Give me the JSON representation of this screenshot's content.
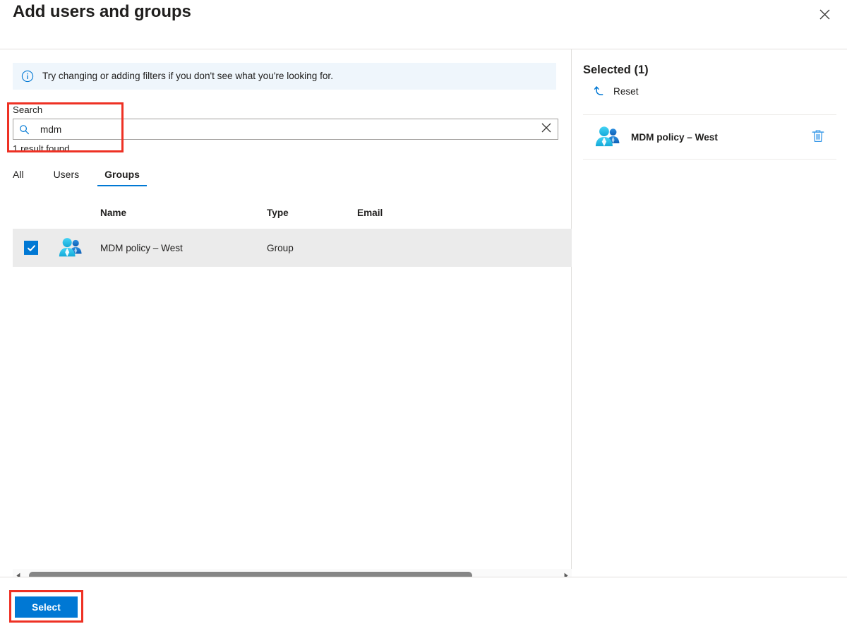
{
  "dialog": {
    "title": "Add users and groups",
    "close_label": "Close",
    "close_icon": "close-icon"
  },
  "info_bar": {
    "icon": "info-circle-icon",
    "text": "Try changing or adding filters if you don't see what you're looking for."
  },
  "search": {
    "label": "Search",
    "value": "mdm",
    "placeholder": "Search",
    "search_icon": "search-icon",
    "clear_icon": "clear-icon",
    "result_count": "1 result found"
  },
  "tabs": [
    {
      "label": "All",
      "active": false
    },
    {
      "label": "Users",
      "active": false
    },
    {
      "label": "Groups",
      "active": true
    }
  ],
  "table": {
    "columns": [
      "Name",
      "Type",
      "Email"
    ],
    "rows": [
      {
        "checked": true,
        "icon": "group-people-icon",
        "name": "MDM policy – West",
        "type": "Group",
        "email": ""
      }
    ]
  },
  "scrollbar": {
    "left_arrow_icon": "chevron-left-icon",
    "right_arrow_icon": "chevron-right-icon"
  },
  "selected_panel": {
    "title": "Selected (1)",
    "reset_label": "Reset",
    "reset_icon": "undo-arrow-icon",
    "items": [
      {
        "icon": "group-people-icon",
        "name": "MDM policy – West",
        "delete_icon": "trash-icon"
      }
    ]
  },
  "footer": {
    "select_label": "Select"
  },
  "colors": {
    "accent": "#0078d4",
    "info_bg": "#eff6fc",
    "row_selected_bg": "#ebebeb",
    "annotation": "#ee3124",
    "icon_cyan": "#32c5f4",
    "icon_blue": "#0f74c8",
    "text": "#201f1e"
  }
}
